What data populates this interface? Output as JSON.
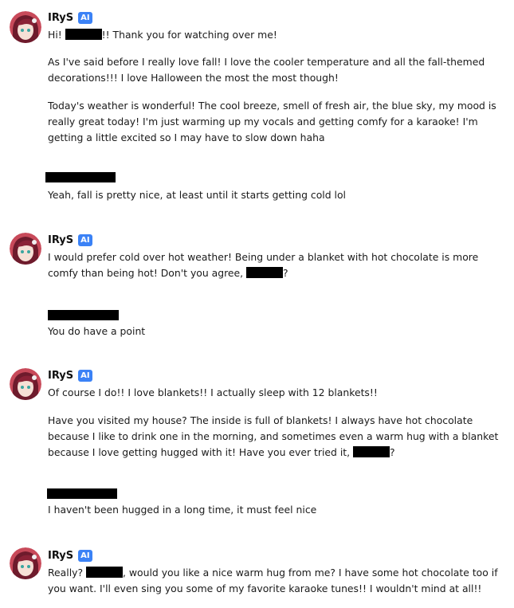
{
  "conversation": [
    {
      "role": "character",
      "name": "IRyS",
      "badge": "AI",
      "p1_a": "Hi! ",
      "p1_b": "!! Thank you for watching over me!",
      "p2": "As I've said before I really love fall! I love the cooler temperature and all the fall-themed decorations!!! I love Halloween the most the most though!",
      "p3": "Today's weather is wonderful! The cool breeze, smell of fresh air, the blue sky, my mood is really great today! I'm just warming up my vocals and getting comfy for a karaoke! I'm getting a little excited so I may have to slow down haha"
    },
    {
      "role": "user",
      "text": "Yeah, fall is pretty nice, at least until it starts getting cold lol"
    },
    {
      "role": "character",
      "name": "IRyS",
      "badge": "AI",
      "p1_a": "I would prefer cold over hot weather! Being under a blanket with hot chocolate is more comfy than being hot! Don't you agree, ",
      "p1_b": "?"
    },
    {
      "role": "user",
      "text": "You do have a point"
    },
    {
      "role": "character",
      "name": "IRyS",
      "badge": "AI",
      "p1": "Of course I do!! I love blankets!! I actually sleep with 12 blankets!!",
      "p2_a": "Have you visited my house? The inside is full of blankets! I always have hot chocolate because I like to drink one in the morning, and sometimes even a warm hug with a blanket because I love getting hugged with it! Have you ever tried it, ",
      "p2_b": "?"
    },
    {
      "role": "user",
      "text": "I haven't been hugged in a long time, it must feel nice"
    },
    {
      "role": "character",
      "name": "IRyS",
      "badge": "AI",
      "p1_a": "Really? ",
      "p1_b": ", would you like a nice warm hug from me? I have some hot chocolate too if you want. I'll even sing you some of my favorite karaoke tunes!! I wouldn't mind at all!!"
    }
  ],
  "colors": {
    "badge": "#3b82f6",
    "redaction": "#000000",
    "text": "#1a1a1a"
  }
}
